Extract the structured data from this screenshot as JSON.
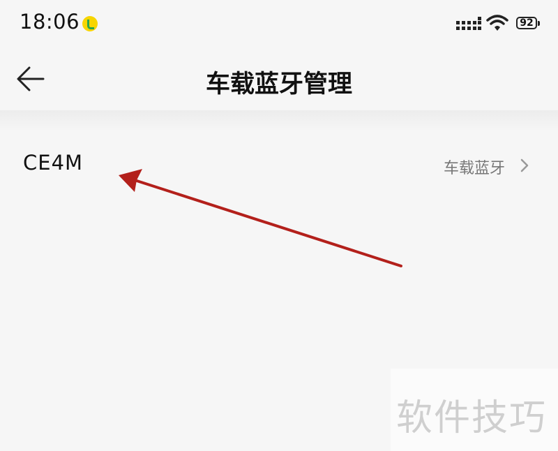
{
  "status_bar": {
    "time": "18:06",
    "battery": "92",
    "icons": [
      "music-app-icon",
      "signal-icon",
      "wifi-icon",
      "battery-icon"
    ]
  },
  "header": {
    "title": "车载蓝牙管理",
    "back_icon": "back-arrow-icon"
  },
  "devices": [
    {
      "name": "CE4M",
      "type": "车载蓝牙",
      "chevron_icon": "chevron-right-icon"
    }
  ],
  "annotation": {
    "arrow_color": "#b3201b"
  },
  "watermark": "软件技巧"
}
